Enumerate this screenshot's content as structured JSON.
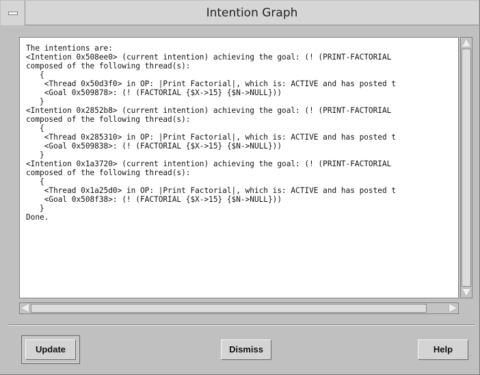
{
  "window": {
    "title": "Intention Graph"
  },
  "text_panel": {
    "lines": [
      "The intentions are:",
      "<Intention 0x508ee0> (current intention) achieving the goal: (! (PRINT-FACTORIAL",
      "composed of the following thread(s):",
      "   {",
      "    <Thread 0x50d3f0> in OP: |Print Factorial|, which is: ACTIVE and has posted t",
      "    <Goal 0x509878>: (! (FACTORIAL {$X->15} {$N->NULL}))",
      "   }",
      "<Intention 0x2852b8> (current intention) achieving the goal: (! (PRINT-FACTORIAL",
      "composed of the following thread(s):",
      "   {",
      "    <Thread 0x285310> in OP: |Print Factorial|, which is: ACTIVE and has posted t",
      "    <Goal 0x509838>: (! (FACTORIAL {$X->15} {$N->NULL}))",
      "   }",
      "<Intention 0x1a3720> (current intention) achieving the goal: (! (PRINT-FACTORIAL",
      "composed of the following thread(s):",
      "   {",
      "    <Thread 0x1a25d0> in OP: |Print Factorial|, which is: ACTIVE and has posted t",
      "    <Goal 0x508f38>: (! (FACTORIAL {$X->15} {$N->NULL}))",
      "   }",
      "Done."
    ]
  },
  "buttons": {
    "update": "Update",
    "dismiss": "Dismiss",
    "help": "Help"
  }
}
